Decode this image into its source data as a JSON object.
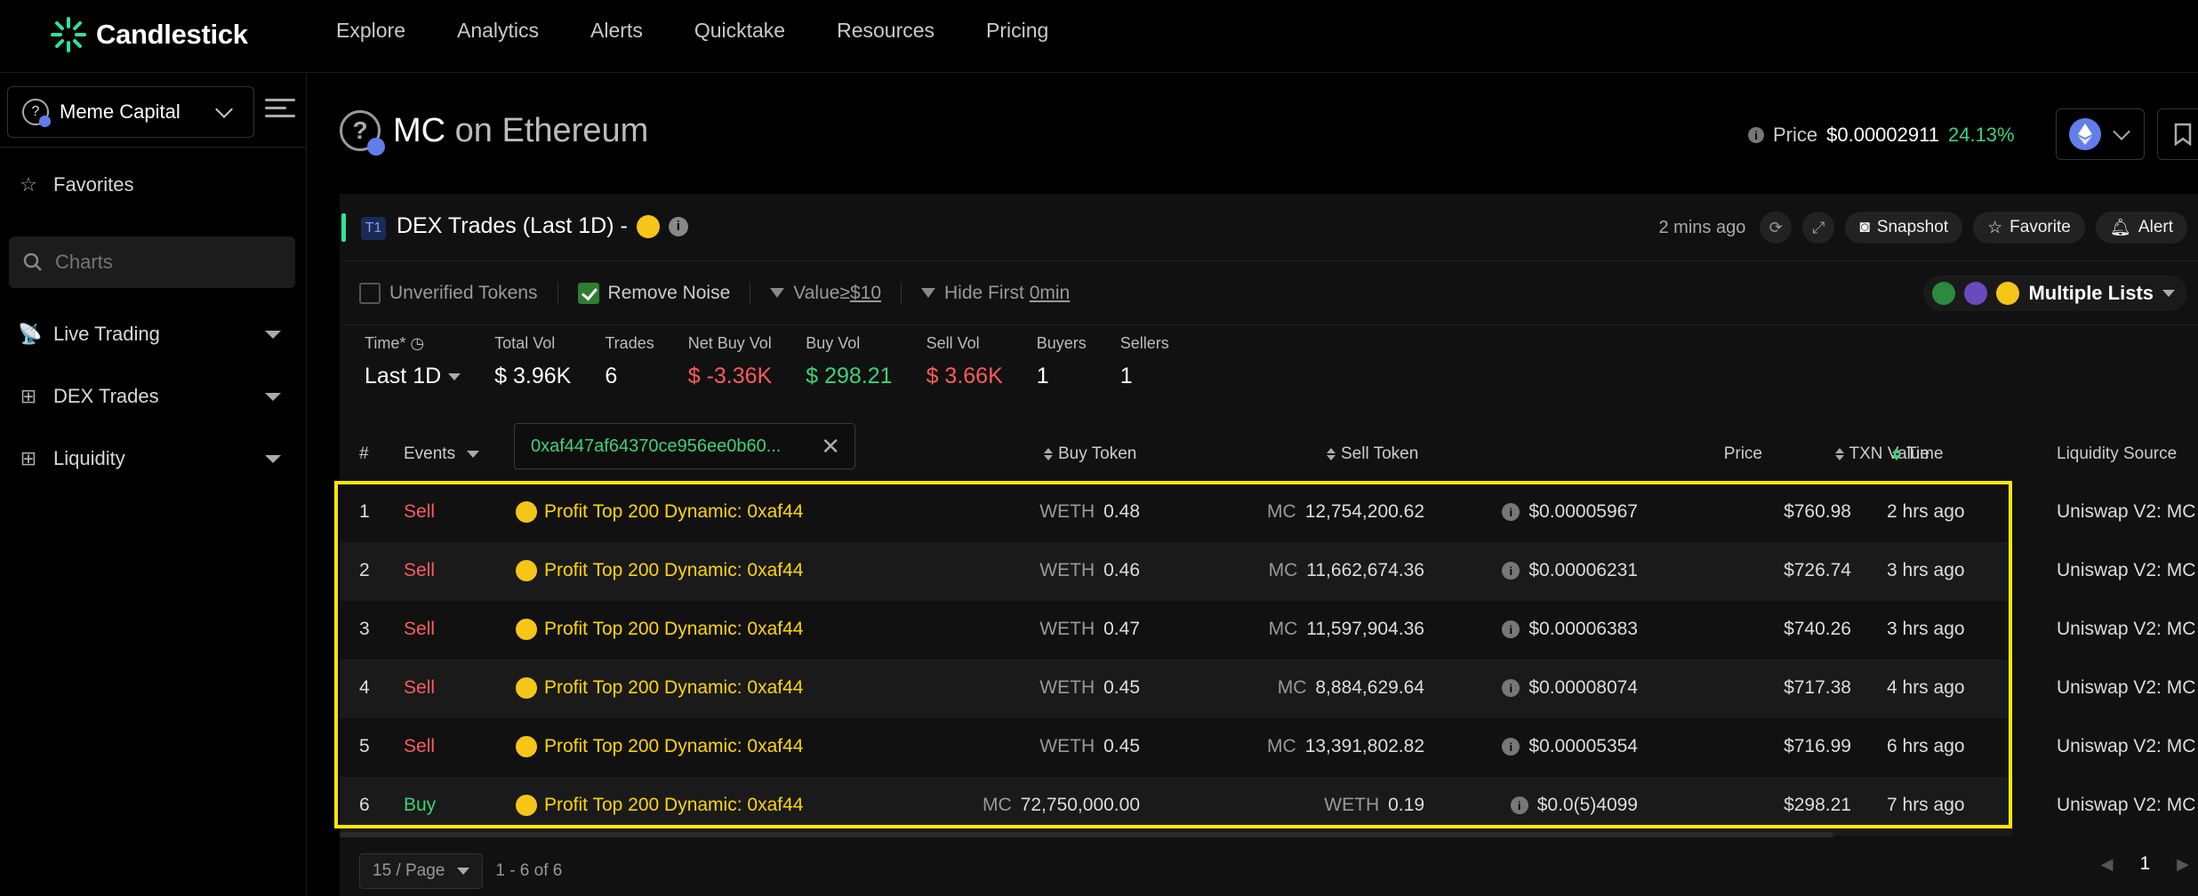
{
  "brand": {
    "name": "Candlestick",
    "accent": "#2ee39a"
  },
  "nav": [
    "Explore",
    "Analytics",
    "Alerts",
    "Quicktake",
    "Resources",
    "Pricing"
  ],
  "sidebar": {
    "workspace": "Meme Capital",
    "items": [
      {
        "label": "Favorites",
        "icon": "star-icon"
      },
      {
        "label": "Live Trading",
        "icon": "antenna-icon"
      },
      {
        "label": "DEX Trades",
        "icon": "plus-box-icon"
      },
      {
        "label": "Liquidity",
        "icon": "plus-box-icon"
      }
    ],
    "search_placeholder": "Charts"
  },
  "header": {
    "token": "MC",
    "chain_text": "on Ethereum",
    "price_label": "Price",
    "price": "$0.00002911",
    "change": "24.13%"
  },
  "panel": {
    "tag": "T1",
    "title": "DEX Trades (Last 1D) -",
    "updated": "2 mins ago",
    "buttons": {
      "snapshot": "Snapshot",
      "favorite": "Favorite",
      "alert": "Alert"
    },
    "filters": {
      "unverified": "Unverified Tokens",
      "remove_noise": "Remove Noise",
      "value_prefix": "Value≥",
      "value_amount": "$10",
      "hide_first_prefix": "Hide First ",
      "hide_first_amount": "0min",
      "lists": "Multiple Lists"
    },
    "stats": {
      "time_label": "Time*",
      "time_value": "Last 1D",
      "total_vol_label": "Total Vol",
      "total_vol": "$ 3.96K",
      "trades_label": "Trades",
      "trades": "6",
      "net_buy_label": "Net Buy Vol",
      "net_buy": "$ -3.36K",
      "buy_vol_label": "Buy Vol",
      "buy_vol": "$ 298.21",
      "sell_vol_label": "Sell Vol",
      "sell_vol": "$ 3.66K",
      "buyers_label": "Buyers",
      "buyers": "1",
      "sellers_label": "Sellers",
      "sellers": "1"
    },
    "columns": {
      "num": "#",
      "events": "Events",
      "address_filter": "0xaf447af64370ce956ee0b60...",
      "buy_token": "Buy Token",
      "sell_token": "Sell Token",
      "price": "Price",
      "txn_value": "TXN Value",
      "time": "Time",
      "liquidity": "Liquidity Source"
    },
    "rows": [
      {
        "n": "1",
        "event": "Sell",
        "trader": "Profit Top 200 Dynamic: 0xaf44",
        "buy_sym": "WETH",
        "buy_amt": "0.48",
        "sell_sym": "MC",
        "sell_amt": "12,754,200.62",
        "price": "$0.00005967",
        "value": "$760.98",
        "time": "2 hrs ago",
        "source": "Uniswap V2: MC"
      },
      {
        "n": "2",
        "event": "Sell",
        "trader": "Profit Top 200 Dynamic: 0xaf44",
        "buy_sym": "WETH",
        "buy_amt": "0.46",
        "sell_sym": "MC",
        "sell_amt": "11,662,674.36",
        "price": "$0.00006231",
        "value": "$726.74",
        "time": "3 hrs ago",
        "source": "Uniswap V2: MC"
      },
      {
        "n": "3",
        "event": "Sell",
        "trader": "Profit Top 200 Dynamic: 0xaf44",
        "buy_sym": "WETH",
        "buy_amt": "0.47",
        "sell_sym": "MC",
        "sell_amt": "11,597,904.36",
        "price": "$0.00006383",
        "value": "$740.26",
        "time": "3 hrs ago",
        "source": "Uniswap V2: MC"
      },
      {
        "n": "4",
        "event": "Sell",
        "trader": "Profit Top 200 Dynamic: 0xaf44",
        "buy_sym": "WETH",
        "buy_amt": "0.45",
        "sell_sym": "MC",
        "sell_amt": "8,884,629.64",
        "price": "$0.00008074",
        "value": "$717.38",
        "time": "4 hrs ago",
        "source": "Uniswap V2: MC"
      },
      {
        "n": "5",
        "event": "Sell",
        "trader": "Profit Top 200 Dynamic: 0xaf44",
        "buy_sym": "WETH",
        "buy_amt": "0.45",
        "sell_sym": "MC",
        "sell_amt": "13,391,802.82",
        "price": "$0.00005354",
        "value": "$716.99",
        "time": "6 hrs ago",
        "source": "Uniswap V2: MC"
      },
      {
        "n": "6",
        "event": "Buy",
        "trader": "Profit Top 200 Dynamic: 0xaf44",
        "buy_sym": "MC",
        "buy_amt": "72,750,000.00",
        "sell_sym": "WETH",
        "sell_amt": "0.19",
        "price": "$0.0(5)4099",
        "value": "$298.21",
        "time": "7 hrs ago",
        "source": "Uniswap V2: MC"
      }
    ],
    "pager": {
      "per_page": "15 / Page",
      "range": "1 - 6 of 6",
      "page": "1"
    }
  },
  "colors": {
    "sell": "#ff5b5b",
    "buy": "#3dd27a",
    "trader": "#ffd600",
    "highlight": "#ffe600"
  }
}
